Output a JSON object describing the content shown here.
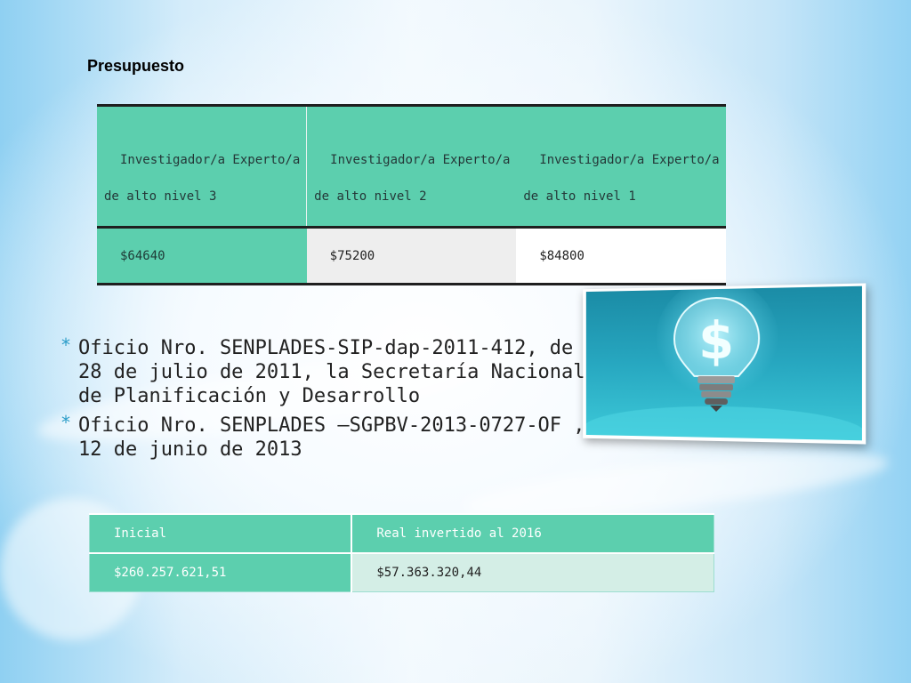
{
  "title": "Presupuesto",
  "salary_table": {
    "headers": [
      "Investigador/a Experto/a de alto nivel 3",
      "Investigador/a Experto/a de alto nivel 2",
      "Investigador/a Experto/a de alto nivel 1"
    ],
    "values": [
      "$64640",
      "$75200",
      "$84800"
    ]
  },
  "bullets": [
    "Oficio Nro. SENPLADES-SIP-dap-2011-412, de 28 de julio de 2011, la Secretaría Nacional de Planificación y Desarrollo",
    "Oficio  Nro. SENPLADES –SGPBV-2013-0727-OF , 12 de junio de 2013"
  ],
  "bullet_marker": "*",
  "budget_table": {
    "headers": [
      "Inicial",
      "Real invertido al 2016"
    ],
    "values": [
      "$260.257.621,51",
      "$57.363.320,44"
    ]
  },
  "illustration": {
    "icon": "lightbulb-dollar-icon",
    "colors": {
      "teal": "#27a7c0",
      "header": "#5ccfae"
    }
  }
}
